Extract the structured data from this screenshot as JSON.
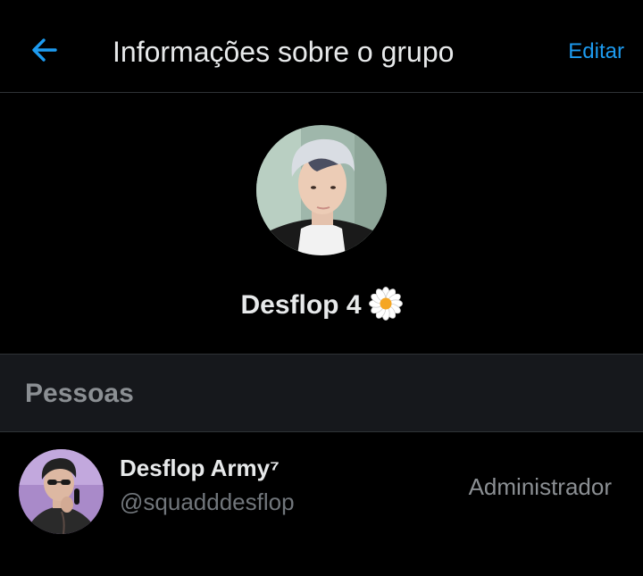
{
  "colors": {
    "background": "#000000",
    "accent": "#1d9bf0",
    "primary_text": "#e7e9ea",
    "secondary_text": "#71767b",
    "section_background": "#16181c",
    "divider": "#2f3336"
  },
  "header": {
    "back_icon": "arrow-left-icon",
    "title": "Informações sobre o grupo",
    "edit_label": "Editar"
  },
  "group": {
    "name": "Desflop 4",
    "emoji_icon": "daisy-icon"
  },
  "people": {
    "title": "Pessoas",
    "members": [
      {
        "display_name": "Desflop Army⁷",
        "handle": "@squadddesflop",
        "role": "Administrador"
      }
    ]
  }
}
